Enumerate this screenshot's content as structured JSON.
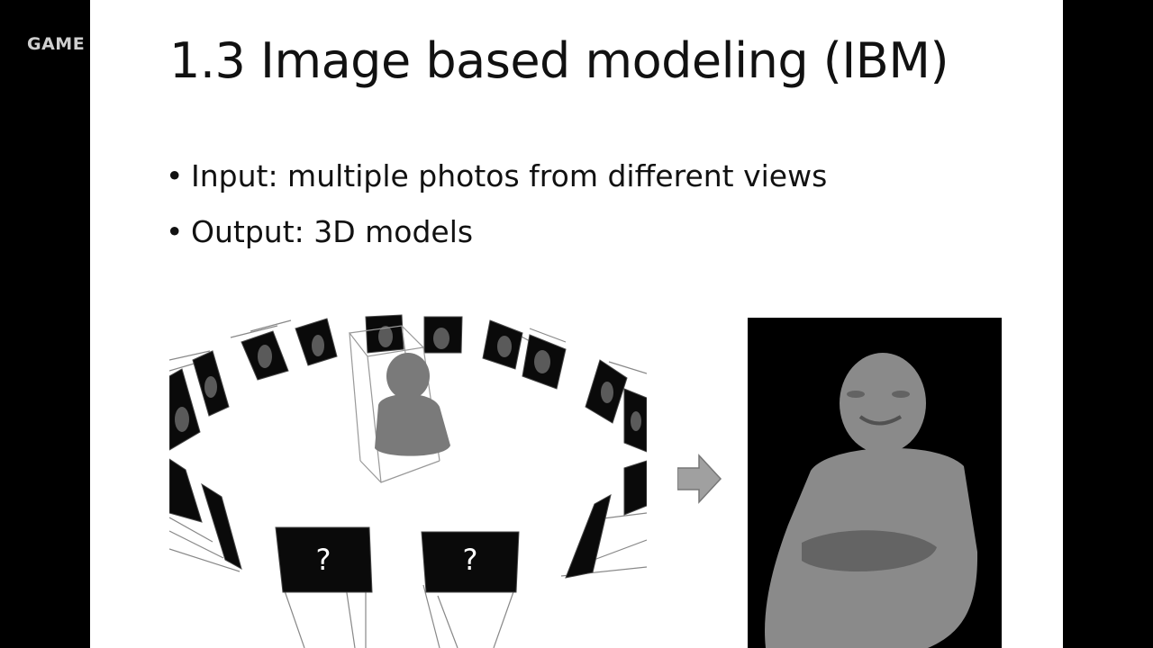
{
  "watermark": "GAME",
  "slide": {
    "title": "1.3 Image based modeling (IBM)",
    "bullets": [
      "Input: multiple photos from different views",
      "Output: 3D models"
    ]
  },
  "figure": {
    "unknown_view_marks": [
      "?",
      "?"
    ]
  },
  "colors": {
    "background": "#000000",
    "slide": "#ffffff",
    "text": "#111111",
    "arrow": "#a0a0a0"
  },
  "icons": {
    "bullet": "bullet-dot-icon",
    "arrow": "right-arrow-icon"
  }
}
